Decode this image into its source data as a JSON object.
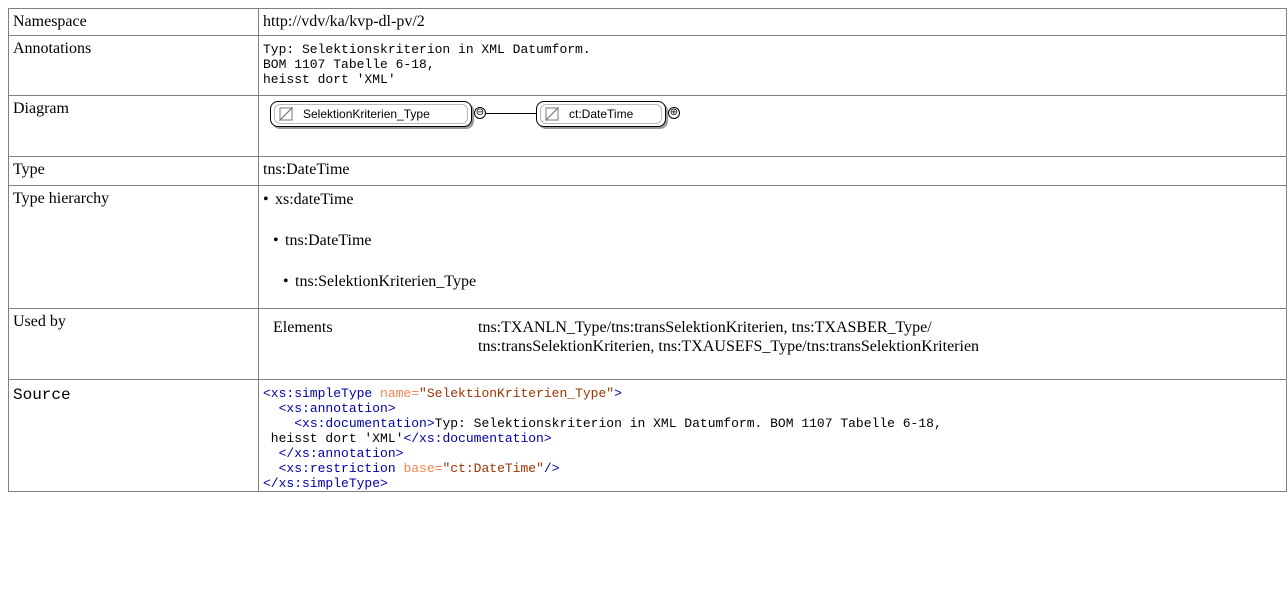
{
  "rows": {
    "namespace": {
      "label": "Namespace",
      "value": "http://vdv/ka/kvp-dl-pv/2"
    },
    "annotations": {
      "label": "Annotations",
      "lines": [
        "Typ: Selektionskriterion in XML Datumform.",
        "BOM 1107 Tabelle 6-18,",
        "heisst dort 'XML'"
      ]
    },
    "diagram": {
      "label": "Diagram",
      "node1": "SelektionKriterien_Type",
      "node2": "ct:DateTime",
      "collapse_symbol": "⊖",
      "expand_symbol": "⊕"
    },
    "type": {
      "label": "Type",
      "value": "tns:DateTime"
    },
    "type_hierarchy": {
      "label": "Type hierarchy",
      "items": [
        "xs:dateTime",
        "tns:DateTime",
        "tns:SelektionKriterien_Type"
      ]
    },
    "used_by": {
      "label": "Used by",
      "kind": "Elements",
      "line1": "tns:TXANLN_Type/tns:transSelektionKriterien, tns:TXASBER_Type/",
      "line2": "tns:transSelektionKriterien, tns:TXAUSEFS_Type/tns:transSelektionKriterien"
    },
    "source": {
      "label": "Source",
      "tag_open": "<xs:simpleType",
      "attr_name": "name=",
      "attr_value": "\"SelektionKriterien_Type\"",
      "gt": ">",
      "annotation_open": "<xs:annotation>",
      "documentation_open": "<xs:documentation>",
      "documentation_text": "Typ: Selektionskriterion in XML Datumform. BOM 1107 Tabelle 6-18,",
      "documentation_text2": " heisst dort 'XML'",
      "documentation_close": "</xs:documentation>",
      "annotation_close": "</xs:annotation>",
      "restriction_open": "<xs:restriction",
      "base_attr": "base=",
      "base_value": "\"ct:DateTime\"",
      "self_close": "/>",
      "simpletype_close": "</xs:simpleType>"
    }
  },
  "colors": {
    "border": "#808080",
    "tag": "#0000aa",
    "attribute": "#f5844c",
    "value": "#993300"
  }
}
